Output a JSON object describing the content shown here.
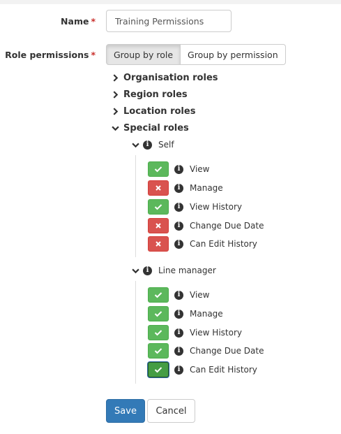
{
  "form": {
    "name_label": "Name",
    "required_mark": "*",
    "name_value": "Training Permissions",
    "role_permissions_label": "Role permissions",
    "group_by_role": "Group by role",
    "group_by_permission": "Group by permission"
  },
  "groups": {
    "organisation": "Organisation roles",
    "region": "Region roles",
    "location": "Location roles",
    "special": "Special roles"
  },
  "special_roles": {
    "self": {
      "label": "Self",
      "permissions": [
        {
          "label": "View",
          "state": "on"
        },
        {
          "label": "Manage",
          "state": "off"
        },
        {
          "label": "View History",
          "state": "on"
        },
        {
          "label": "Change Due Date",
          "state": "off"
        },
        {
          "label": "Can Edit History",
          "state": "off"
        }
      ]
    },
    "line_manager": {
      "label": "Line manager",
      "permissions": [
        {
          "label": "View",
          "state": "on"
        },
        {
          "label": "Manage",
          "state": "on"
        },
        {
          "label": "View History",
          "state": "on"
        },
        {
          "label": "Change Due Date",
          "state": "on"
        },
        {
          "label": "Can Edit History",
          "state": "on"
        }
      ]
    }
  },
  "actions": {
    "save": "Save",
    "cancel": "Cancel"
  },
  "colors": {
    "on": "#5cb85c",
    "off": "#d9534f",
    "primary": "#337ab7"
  }
}
